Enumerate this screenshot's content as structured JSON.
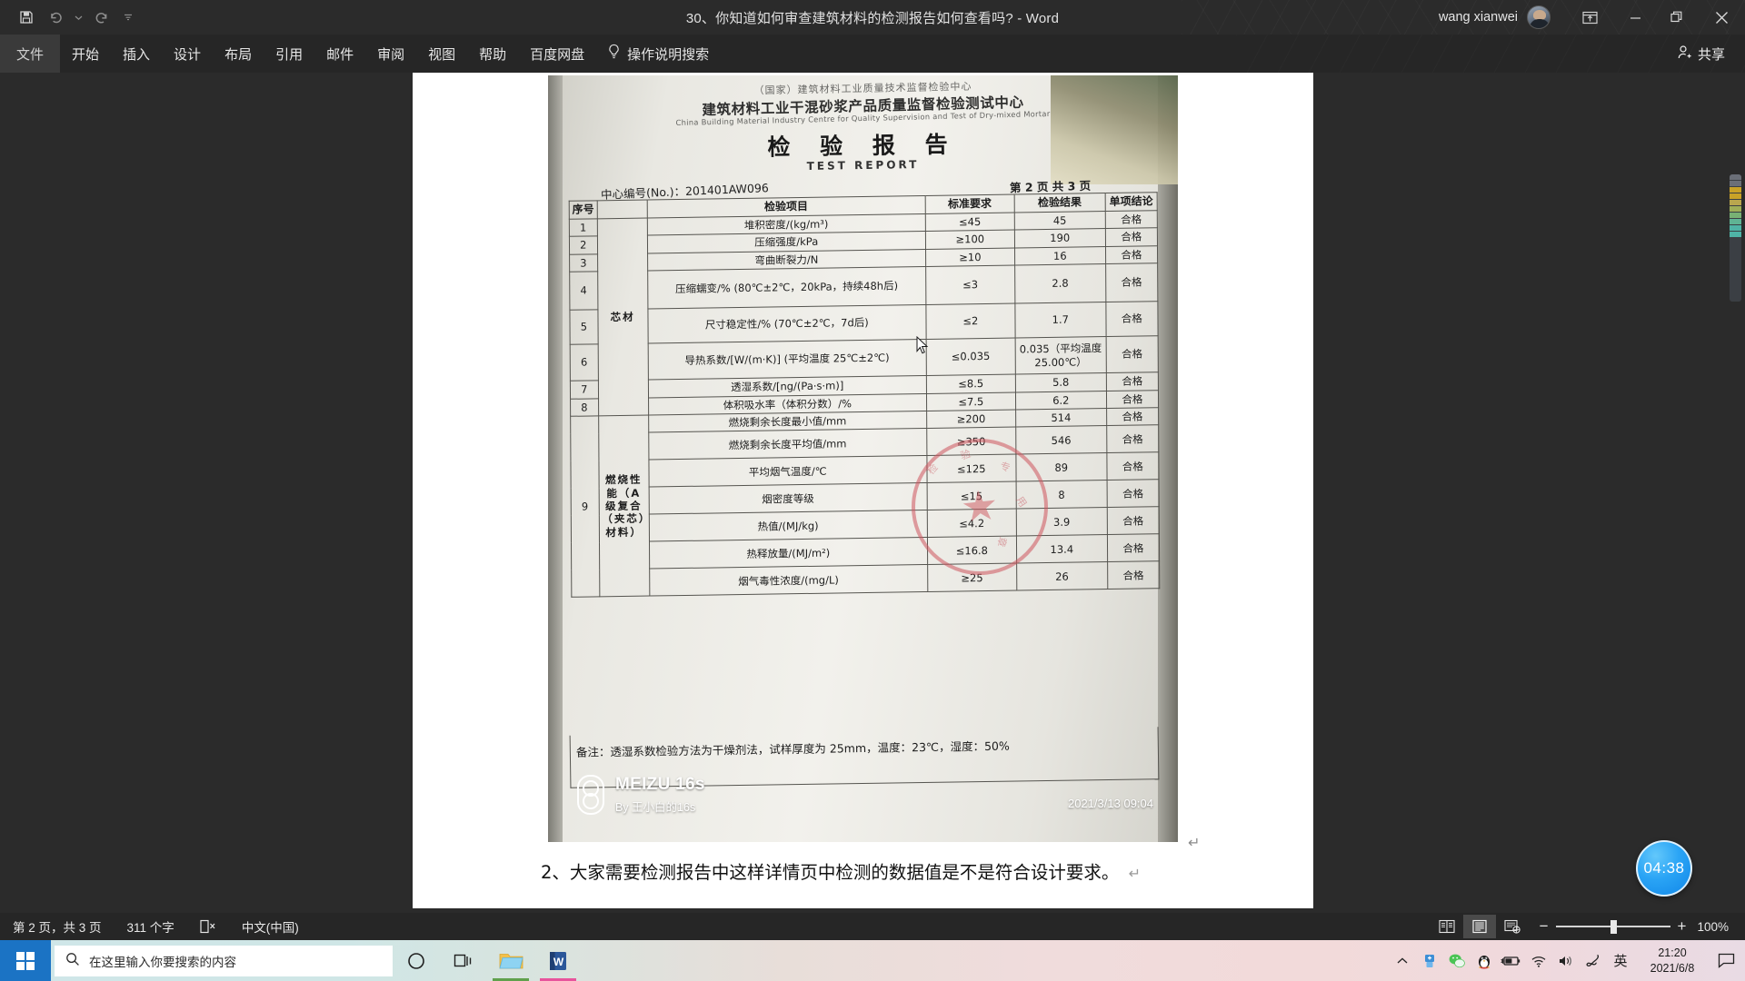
{
  "window": {
    "title": "30、你知道如何审查建筑材料的检测报告如何查看吗?   -  Word",
    "user_name": "wang xianwei",
    "quick_access": [
      {
        "name": "save-button",
        "icon": "save-icon"
      },
      {
        "name": "undo-button",
        "icon": "undo-icon"
      },
      {
        "name": "undo-dropdown",
        "icon": "chevron-down-icon"
      },
      {
        "name": "redo-button",
        "icon": "redo-icon"
      },
      {
        "name": "customize-qat-button",
        "icon": "overflow-icon"
      }
    ],
    "controls": {
      "ribbon_display": "ribbon-display-options",
      "minimize": "minimize",
      "restore": "restore",
      "close": "close"
    }
  },
  "ribbon": {
    "tabs": [
      {
        "label": "文件",
        "active": true
      },
      {
        "label": "开始",
        "active": false
      },
      {
        "label": "插入",
        "active": false
      },
      {
        "label": "设计",
        "active": false
      },
      {
        "label": "布局",
        "active": false
      },
      {
        "label": "引用",
        "active": false
      },
      {
        "label": "邮件",
        "active": false
      },
      {
        "label": "审阅",
        "active": false
      },
      {
        "label": "视图",
        "active": false
      },
      {
        "label": "帮助",
        "active": false
      },
      {
        "label": "百度网盘",
        "active": false
      }
    ],
    "tell_me": "操作说明搜索",
    "share_label": "共享"
  },
  "document": {
    "caption": "2、大家需要检测报告中这样详情页中检测的数据值是不是符合设计要求。",
    "image": {
      "org_small": "（国家）建筑材料工业质量技术监督检验中心",
      "org_title": "建筑材料工业干混砂浆产品质量监督检验测试中心",
      "org_title_en": "China Building Material Industry Centre for Quality Supervision and Test of Dry-mixed Mortar",
      "report_title": "检 验 报 告",
      "report_title_en": "TEST   REPORT",
      "report_no": "中心编号(No.)：201401AW096",
      "page_info": "第 2 页  共 3 页",
      "table_headers": {
        "no": "序号",
        "item": "检验项目",
        "standard": "标准要求",
        "result": "检验结果",
        "conclusion": "单项结论"
      },
      "group_labels": {
        "core": "芯材",
        "burn": "燃烧性能（A级复合（夹芯）材料）"
      },
      "rows": [
        {
          "no": "1",
          "item": "堆积密度/(kg/m³)",
          "standard": "≤45",
          "result": "45",
          "conclusion": "合格"
        },
        {
          "no": "2",
          "item": "压缩强度/kPa",
          "standard": "≥100",
          "result": "190",
          "conclusion": "合格"
        },
        {
          "no": "3",
          "item": "弯曲断裂力/N",
          "standard": "≥10",
          "result": "16",
          "conclusion": "合格"
        },
        {
          "no": "4",
          "item": "压缩蠕变/% (80℃±2℃，20kPa，持续48h后)",
          "standard": "≤3",
          "result": "2.8",
          "conclusion": "合格"
        },
        {
          "no": "5",
          "item": "尺寸稳定性/% (70℃±2℃，7d后)",
          "standard": "≤2",
          "result": "1.7",
          "conclusion": "合格"
        },
        {
          "no": "6",
          "item": "导热系数/[W/(m·K)] (平均温度 25℃±2℃)",
          "standard": "≤0.035",
          "result": "0.035（平均温度 25.00℃）",
          "conclusion": "合格"
        },
        {
          "no": "7",
          "item": "透湿系数/[ng/(Pa·s·m)]",
          "standard": "≤8.5",
          "result": "5.8",
          "conclusion": "合格"
        },
        {
          "no": "8",
          "item": "体积吸水率（体积分数）/%",
          "standard": "≤7.5",
          "result": "6.2",
          "conclusion": "合格"
        },
        {
          "no": "9",
          "item": "燃烧剩余长度最小值/mm",
          "standard": "≥200",
          "result": "514",
          "conclusion": "合格"
        },
        {
          "no": "",
          "item": "燃烧剩余长度平均值/mm",
          "standard": "≥350",
          "result": "546",
          "conclusion": "合格"
        },
        {
          "no": "",
          "item": "平均烟气温度/℃",
          "standard": "≤125",
          "result": "89",
          "conclusion": "合格"
        },
        {
          "no": "",
          "item": "烟密度等级",
          "standard": "≤15",
          "result": "8",
          "conclusion": "合格"
        },
        {
          "no": "",
          "item": "热值/(MJ/kg)",
          "standard": "≤4.2",
          "result": "3.9",
          "conclusion": "合格"
        },
        {
          "no": "",
          "item": "热释放量/(MJ/m²)",
          "standard": "≤16.8",
          "result": "13.4",
          "conclusion": "合格"
        },
        {
          "no": "",
          "item": "烟气毒性浓度/(mg/L)",
          "standard": "≥25",
          "result": "26",
          "conclusion": "合格"
        }
      ],
      "note": "备注：透湿系数检验方法为干燥剂法，试样厚度为 25mm，温度：23℃，湿度：50%",
      "watermark": {
        "brand": "MEIZU 16s",
        "by": "By 王小白的16s",
        "datetime": "2021/3/13  09:04"
      },
      "stamp_text": "检验专用章"
    }
  },
  "status_bar": {
    "page_info": "第 2 页，共 3 页",
    "word_count": "311 个字",
    "proofing_icon": "proofing-errors-icon",
    "language": "中文(中国)",
    "views": [
      {
        "name": "read-mode-view",
        "label": "阅读视图"
      },
      {
        "name": "print-layout-view",
        "label": "页面视图",
        "active": true
      },
      {
        "name": "web-layout-view",
        "label": "Web 版式视图"
      }
    ],
    "zoom_out": "−",
    "zoom_in": "+",
    "zoom_level": "100%"
  },
  "overlay": {
    "timer": "04:38"
  },
  "taskbar": {
    "start": "start-button",
    "search_placeholder": "在这里输入你要搜索的内容",
    "items": [
      {
        "name": "cortana-button",
        "icon": "circle-icon"
      },
      {
        "name": "task-view-button",
        "icon": "task-view-icon"
      },
      {
        "name": "file-explorer-button",
        "icon": "folder-icon"
      },
      {
        "name": "word-taskbar-button",
        "icon": "word-icon"
      }
    ],
    "tray": [
      {
        "name": "show-hidden-icons",
        "icon": "chevron-up-icon"
      },
      {
        "name": "usb-safely-remove",
        "icon": "usb-icon"
      },
      {
        "name": "wechat-tray-icon",
        "icon": "wechat-icon"
      },
      {
        "name": "qq-tray-icon",
        "icon": "penguin-icon"
      },
      {
        "name": "battery-tray-icon",
        "icon": "battery-icon"
      },
      {
        "name": "network-tray-icon",
        "icon": "wifi-icon"
      },
      {
        "name": "volume-tray-icon",
        "icon": "speaker-icon"
      },
      {
        "name": "ime-tray-icon",
        "icon": "pen-icon"
      },
      {
        "name": "ime-mode",
        "icon": "english-mode-icon",
        "label": "英"
      }
    ],
    "clock": {
      "time": "21:20",
      "date": "2021/6/8"
    },
    "notification": "action-center-button"
  },
  "colors": {
    "titlebar": "#2b2b2b",
    "ribbon": "#262626",
    "page": "#ffffff",
    "accent_bubble": "#2aa4f5",
    "start_button": "#1b73c4"
  }
}
